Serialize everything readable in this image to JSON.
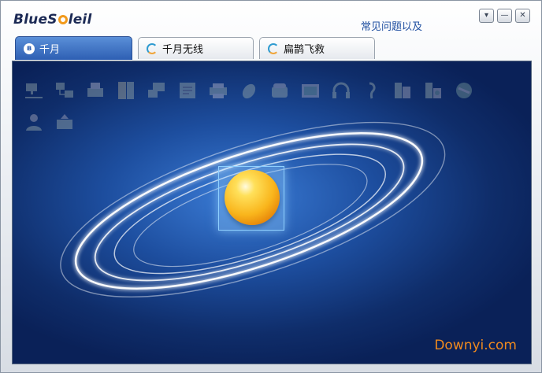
{
  "app": {
    "logo_text_1": "BlueS",
    "logo_text_2": "leil"
  },
  "header": {
    "faq_label": "常见问题以及"
  },
  "window_controls": {
    "dropdown": "▾",
    "minimize": "—",
    "close": "✕"
  },
  "tabs": [
    {
      "label": "千月",
      "active": true,
      "icon": "bluetooth-icon"
    },
    {
      "label": "千月无线",
      "active": false,
      "icon": "swirl-icon"
    },
    {
      "label": "扁鹊飞救",
      "active": false,
      "icon": "swirl-icon"
    }
  ],
  "toolbar_row1": [
    "network-icon",
    "lan-access-icon",
    "fax-icon",
    "file-transfer-icon",
    "dialup-network-icon",
    "object-push-icon",
    "printer-icon",
    "mouse-icon",
    "phone-icon",
    "picture-icon",
    "headphones-icon",
    "headset-icon",
    "sync-icon",
    "pim-icon",
    "av-icon"
  ],
  "toolbar_row2": [
    "user-icon",
    "hid-icon"
  ],
  "colors": {
    "accent": "#2e5fb3",
    "panel_bg": "#0f2d6a",
    "orb": "#f9b51c",
    "watermark": "#f08a1e"
  },
  "watermark": {
    "text": "Downyi.com"
  }
}
